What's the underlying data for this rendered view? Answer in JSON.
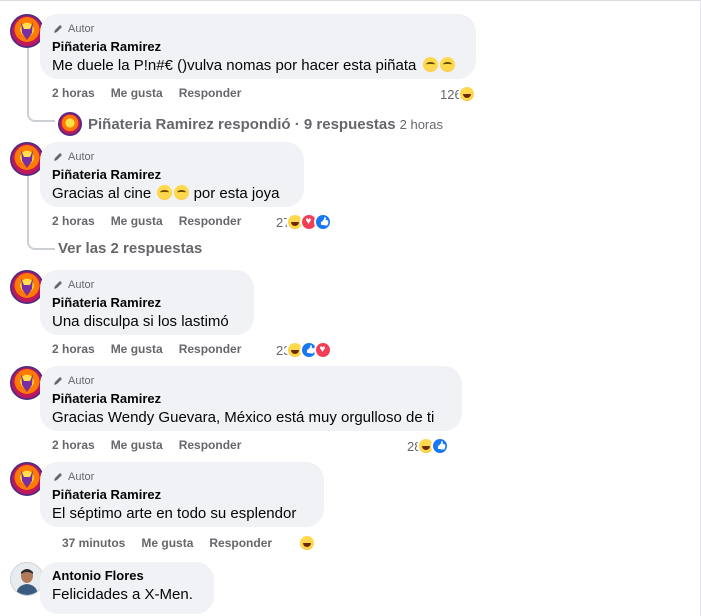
{
  "badge_label": "Autor",
  "comments": [
    {
      "name": "Piñateria Ramirez",
      "text": "Me duele la P!n#€ ()vulva nomas por hacer esta piñata",
      "time": "2 horas",
      "like_label": "Me gusta",
      "reply_label": "Responder",
      "reaction_count": "126",
      "reactions": [
        "haha"
      ]
    },
    {
      "name": "Piñateria Ramirez",
      "text_before": "Gracias al cine",
      "text_after": "por esta joya",
      "time": "2 horas",
      "like_label": "Me gusta",
      "reply_label": "Responder",
      "reaction_count": "27",
      "reactions": [
        "haha",
        "love",
        "like"
      ]
    },
    {
      "name": "Piñateria Ramirez",
      "text": "Una disculpa si los lastimó",
      "time": "2 horas",
      "like_label": "Me gusta",
      "reply_label": "Responder",
      "reaction_count": "23",
      "reactions": [
        "haha",
        "like",
        "love"
      ]
    },
    {
      "name": "Piñateria Ramirez",
      "text": "Gracias Wendy Guevara, México está muy orgulloso de ti",
      "time": "2 horas",
      "like_label": "Me gusta",
      "reply_label": "Responder",
      "reaction_count": "28",
      "reactions": [
        "haha",
        "like"
      ]
    },
    {
      "name": "Piñateria Ramirez",
      "text": "El séptimo arte en todo su esplendor",
      "time": "37 minutos",
      "like_label": "Me gusta",
      "reply_label": "Responder",
      "reaction_count": "",
      "reactions": [
        "haha"
      ]
    },
    {
      "name": "Antonio Flores",
      "text": "Felicidades a X-Men."
    }
  ],
  "reply_summary": {
    "text": "Piñateria Ramirez respondió · 9 respuestas",
    "time": "2 horas"
  },
  "view_replies": "Ver las 2 respuestas"
}
